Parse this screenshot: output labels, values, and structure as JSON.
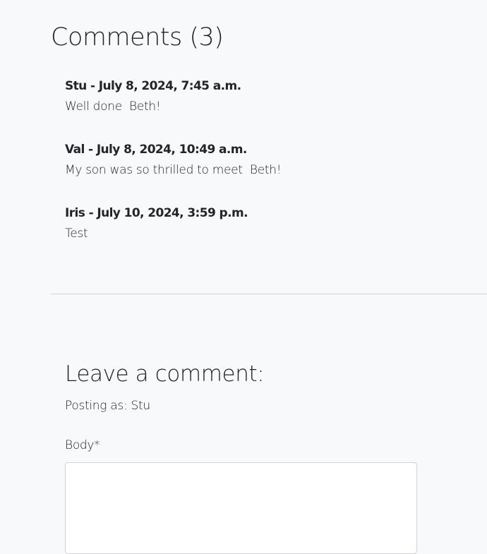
{
  "comments_section": {
    "heading": "Comments (3)",
    "comments": [
      {
        "meta": "Stu - July 8, 2024, 7:45 a.m.",
        "body": "Well done  Beth!"
      },
      {
        "meta": "Val - July 8, 2024, 10:49 a.m.",
        "body": "My son was so thrilled to meet  Beth!"
      },
      {
        "meta": "Iris - July 10, 2024, 3:59 p.m.",
        "body": "Test"
      }
    ]
  },
  "comment_form": {
    "heading": "Leave a comment:",
    "posting_as": "Posting as: Stu",
    "body_label": "Body*",
    "body_value": ""
  }
}
